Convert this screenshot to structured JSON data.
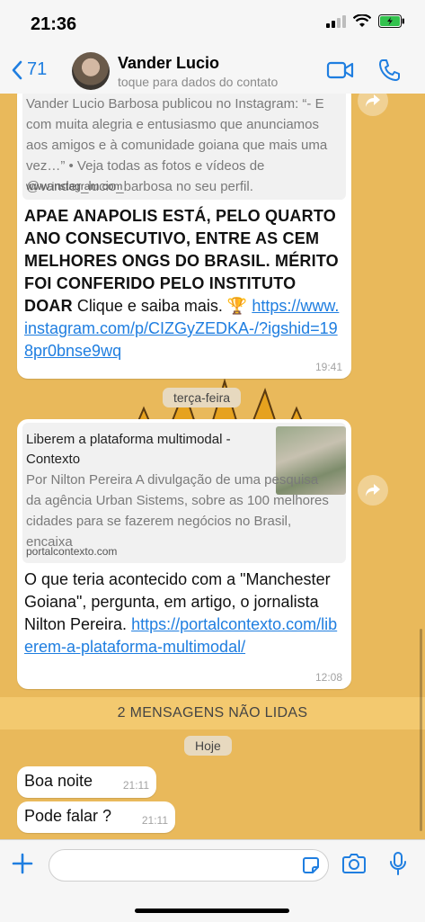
{
  "status": {
    "time": "21:36"
  },
  "header": {
    "back_count": "71",
    "contact_name": "Vander Lucio",
    "contact_subtitle": "toque para dados do contato"
  },
  "messages": {
    "m1": {
      "preview_text": "Vander Lucio Barbosa publicou no Instagram: “- E com muita alegria e entusiasmo que anunciamos aos amigos e à comunidade goiana que mais uma vez…” • Veja todas as fotos e vídeos de @vander_lucio_barbosa no seu perfil.",
      "preview_domain": "www.instagram.com",
      "bold_text": "APAE ANAPOLIS ESTÁ, PELO QUARTO ANO CONSECUTIVO, ENTRE AS CEM MELHORES ONGS DO BRASIL. MÉRITO FOI CONFERIDO PELO INSTITUTO DOAR",
      "text": " Clique e saiba mais. 🏆 ",
      "link": "https://www.instagram.com/p/CIZGyZEDKA-/?igshid=198pr0bnse9wq",
      "time": "19:41"
    },
    "day_label_1": "terça-feira",
    "m2": {
      "preview_title": "Liberem a plataforma multimodal - Contexto",
      "preview_text": "Por Nilton Pereira A divulgação de uma pesquisa da agência Urban Sistems, sobre as 100 melhores cidades para se fazerem negócios no Brasil, encaixa",
      "preview_domain": "portalcontexto.com",
      "text": "O que teria acontecido com a \"Manchester Goiana\", pergunta, em artigo, o jornalista Nilton Pereira. ",
      "link": "https://portalcontexto.com/liberem-a-plataforma-multimodal/",
      "time": "12:08"
    },
    "unread_banner": "2 MENSAGENS NÃO LIDAS",
    "day_label_2": "Hoje",
    "m3": {
      "text": "Boa noite",
      "time": "21:11"
    },
    "m4": {
      "text": "Pode falar ?",
      "time": "21:11"
    }
  },
  "colors": {
    "accent": "#1f7ee0",
    "chat_bg": "#e9b95b",
    "unread_bg": "#f3c96f"
  },
  "icons": [
    "signal-icon",
    "wifi-icon",
    "battery-icon",
    "back-chevron-icon",
    "video-call-icon",
    "phone-icon",
    "forward-icon",
    "plus-icon",
    "sticker-icon",
    "camera-icon",
    "microphone-icon"
  ]
}
